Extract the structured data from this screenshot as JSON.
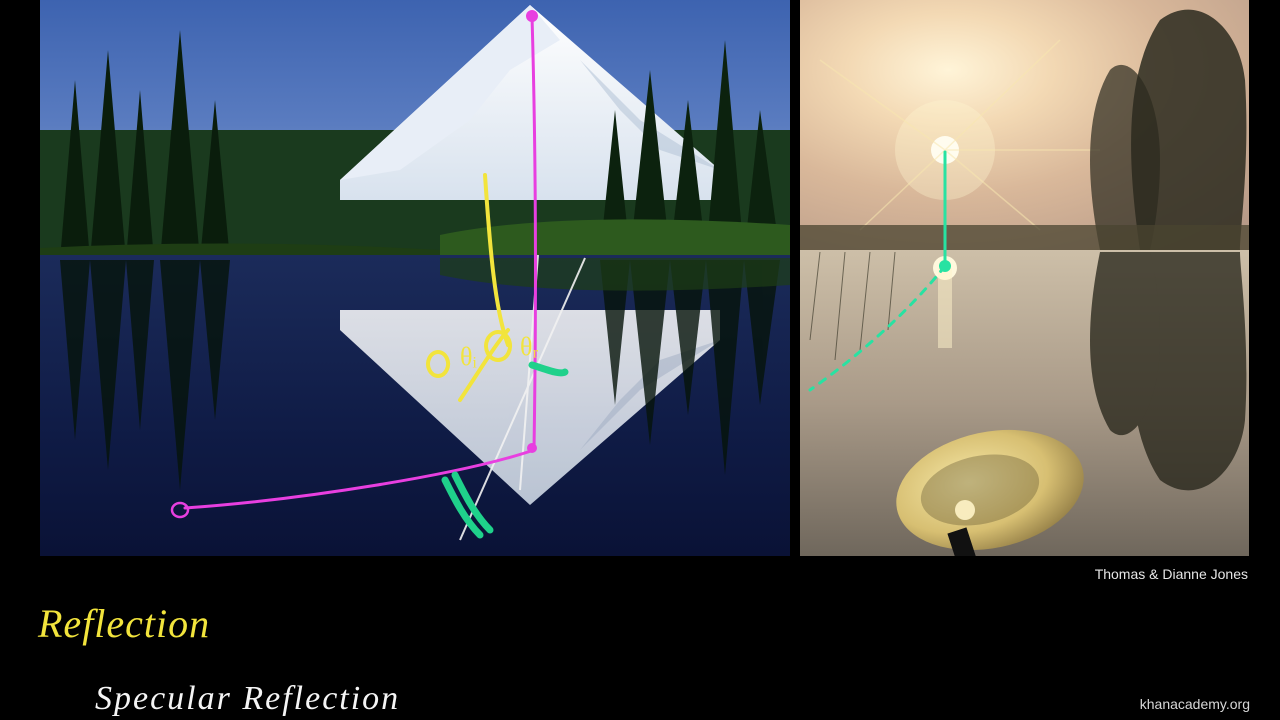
{
  "credit": "Thomas & Dianne Jones",
  "site": "khanacademy.org",
  "title_yellow": "Reflection",
  "subtitle_white": "Specular  Reflection",
  "annotations": {
    "left": {
      "theta_i": "θᵢ",
      "theta_r": "θᵣ"
    }
  },
  "colors": {
    "magenta": "#e83fe0",
    "yellow": "#f2e43c",
    "green": "#1fd18b",
    "white_line": "#f2f2f2"
  }
}
